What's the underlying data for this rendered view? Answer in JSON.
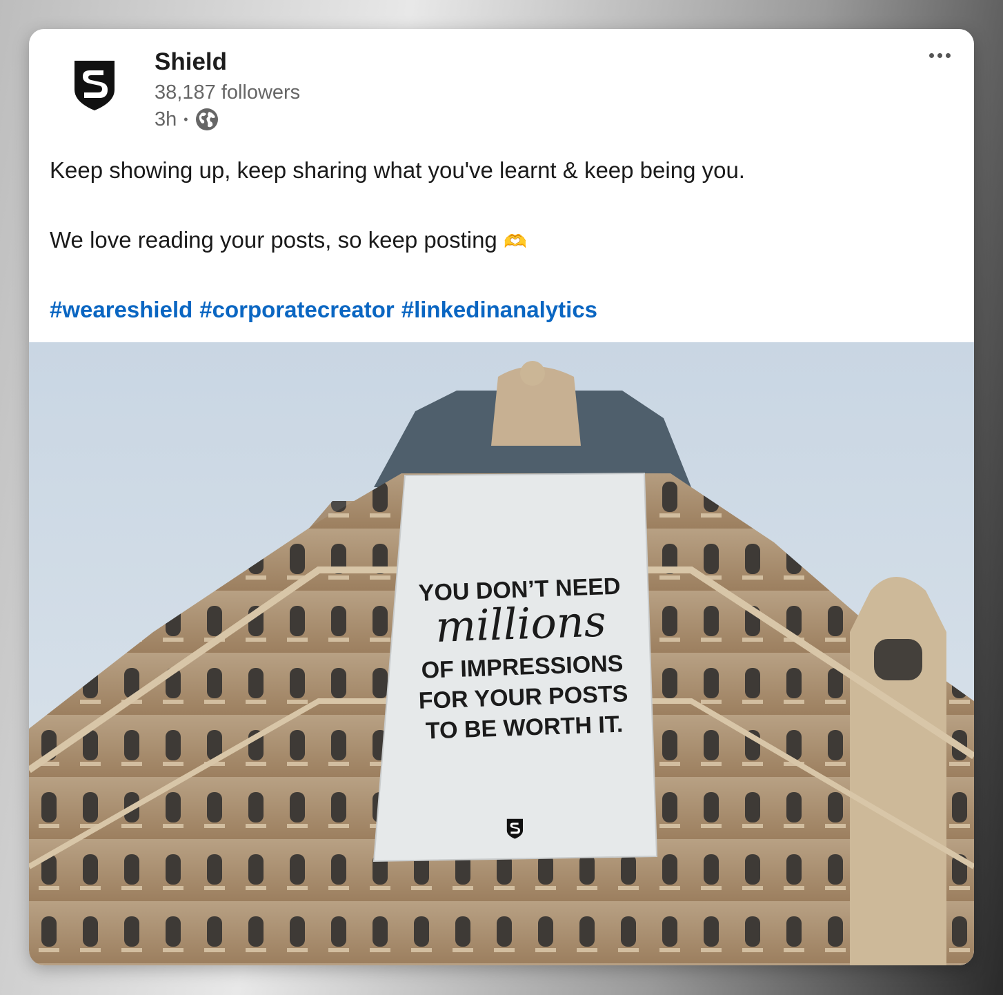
{
  "post": {
    "author": {
      "name": "Shield",
      "followers": "38,187 followers",
      "time": "3h",
      "separator": "•",
      "visibility_icon": "globe-icon"
    },
    "more_icon": "more-horizontal-icon",
    "text_line1": "Keep showing up, keep sharing what you've learnt & keep being you.",
    "text_line2": "We love reading your posts, so keep posting",
    "text_emoji": "🫶",
    "hashtags": [
      "#weareshield",
      "#corporatecreator",
      "#linkedinanalytics"
    ],
    "image": {
      "banner_lines": [
        "YOU DON’T NEED",
        "millions",
        "OF IMPRESSIONS",
        "FOR YOUR POSTS",
        "TO BE WORTH IT."
      ]
    }
  },
  "colors": {
    "hashtag": "#0a66c2",
    "text": "#1a1a1a",
    "muted": "#666666"
  }
}
